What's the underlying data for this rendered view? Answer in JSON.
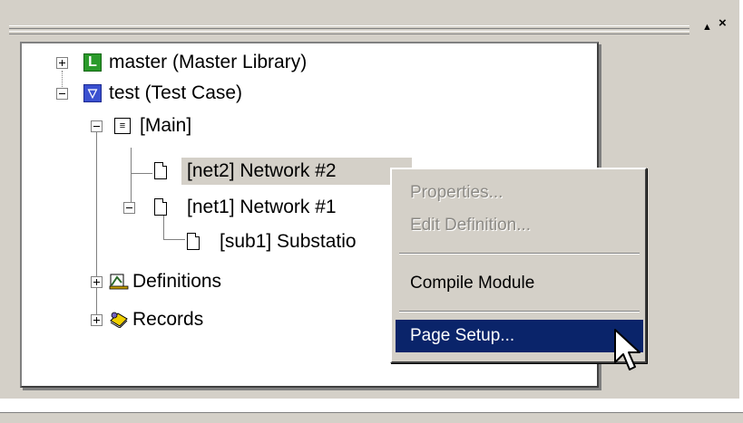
{
  "window": {
    "pin_label": "▲",
    "close_label": "×"
  },
  "tree": {
    "items": [
      {
        "label": "master (Master Library)",
        "icon": "library-icon",
        "expander": "+"
      },
      {
        "label": "test (Test Case)",
        "icon": "test-case-icon",
        "expander": "-"
      },
      {
        "label": "[Main]",
        "icon": "module-icon",
        "expander": "-"
      },
      {
        "label": "[net2] Network #2",
        "icon": "document-icon",
        "selected": true
      },
      {
        "label": "[net1] Network #1",
        "icon": "document-icon",
        "expander": "-"
      },
      {
        "label": "[sub1] Substatio",
        "icon": "document-icon"
      },
      {
        "label": "Definitions",
        "icon": "definitions-icon",
        "expander": "+"
      },
      {
        "label": "Records",
        "icon": "records-icon",
        "expander": "+"
      }
    ]
  },
  "context_menu": {
    "items": [
      {
        "label": "Properties...",
        "enabled": false
      },
      {
        "label": "Edit Definition...",
        "enabled": false
      },
      {
        "label": "Compile Module",
        "enabled": true
      },
      {
        "label": "Page Setup...",
        "enabled": true,
        "highlighted": true
      }
    ],
    "highlight_color": "#0a246a",
    "disabled_color": "#8c8a85"
  },
  "colors": {
    "chrome": "#d4d0c8",
    "library_icon": "#2a9a2a",
    "test_icon": "#3a50d0"
  }
}
